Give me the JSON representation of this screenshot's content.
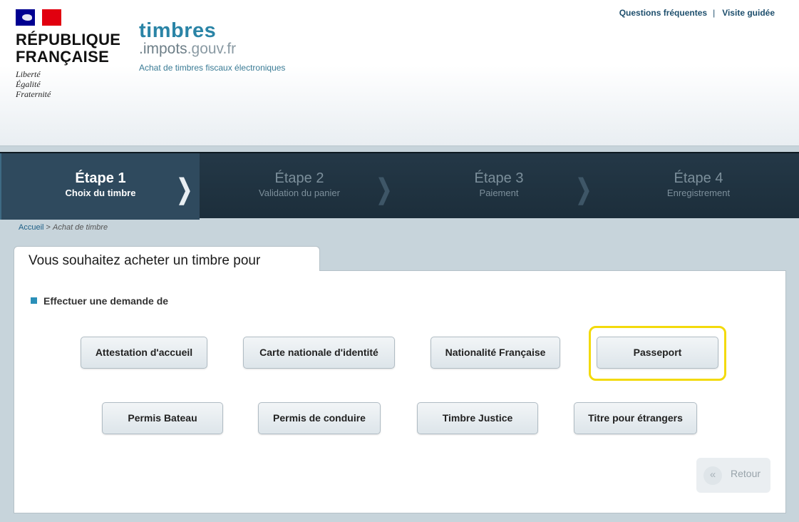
{
  "header": {
    "rf_title_line1": "RÉPUBLIQUE",
    "rf_title_line2": "FRANÇAISE",
    "motto": [
      "Liberté",
      "Égalité",
      "Fraternité"
    ],
    "site_name": "timbres",
    "site_domain_prefix": ".impots",
    "site_domain_suffix": ".gouv.fr",
    "tagline": "Achat de timbres fiscaux électroniques",
    "links": {
      "faq": "Questions fréquentes",
      "separator": "|",
      "tour": "Visite guidée"
    }
  },
  "stepper": {
    "steps": [
      {
        "num": "Étape 1",
        "label": "Choix du timbre",
        "active": true
      },
      {
        "num": "Étape 2",
        "label": "Validation du panier",
        "active": false
      },
      {
        "num": "Étape 3",
        "label": "Paiement",
        "active": false
      },
      {
        "num": "Étape 4",
        "label": "Enregistrement",
        "active": false
      }
    ],
    "chevron": "❯"
  },
  "breadcrumb": {
    "home": "Accueil",
    "separator": ">",
    "current": "Achat de timbre"
  },
  "panel": {
    "tab_title": "Vous souhaitez acheter un timbre pour",
    "section_label": "Effectuer une demande de",
    "options": [
      "Attestation d'accueil",
      "Carte nationale d'identité",
      "Nationalité Française",
      "Passeport",
      "Permis Bateau",
      "Permis de conduire",
      "Timbre Justice",
      "Titre pour étrangers"
    ],
    "back_label": "Retour",
    "back_icon": "«"
  },
  "colors": {
    "accent_blue": "#2a84a6",
    "stepper_bg": "#1c2e3b",
    "active_step": "#2f4a5e",
    "highlight": "#f3da0b"
  }
}
